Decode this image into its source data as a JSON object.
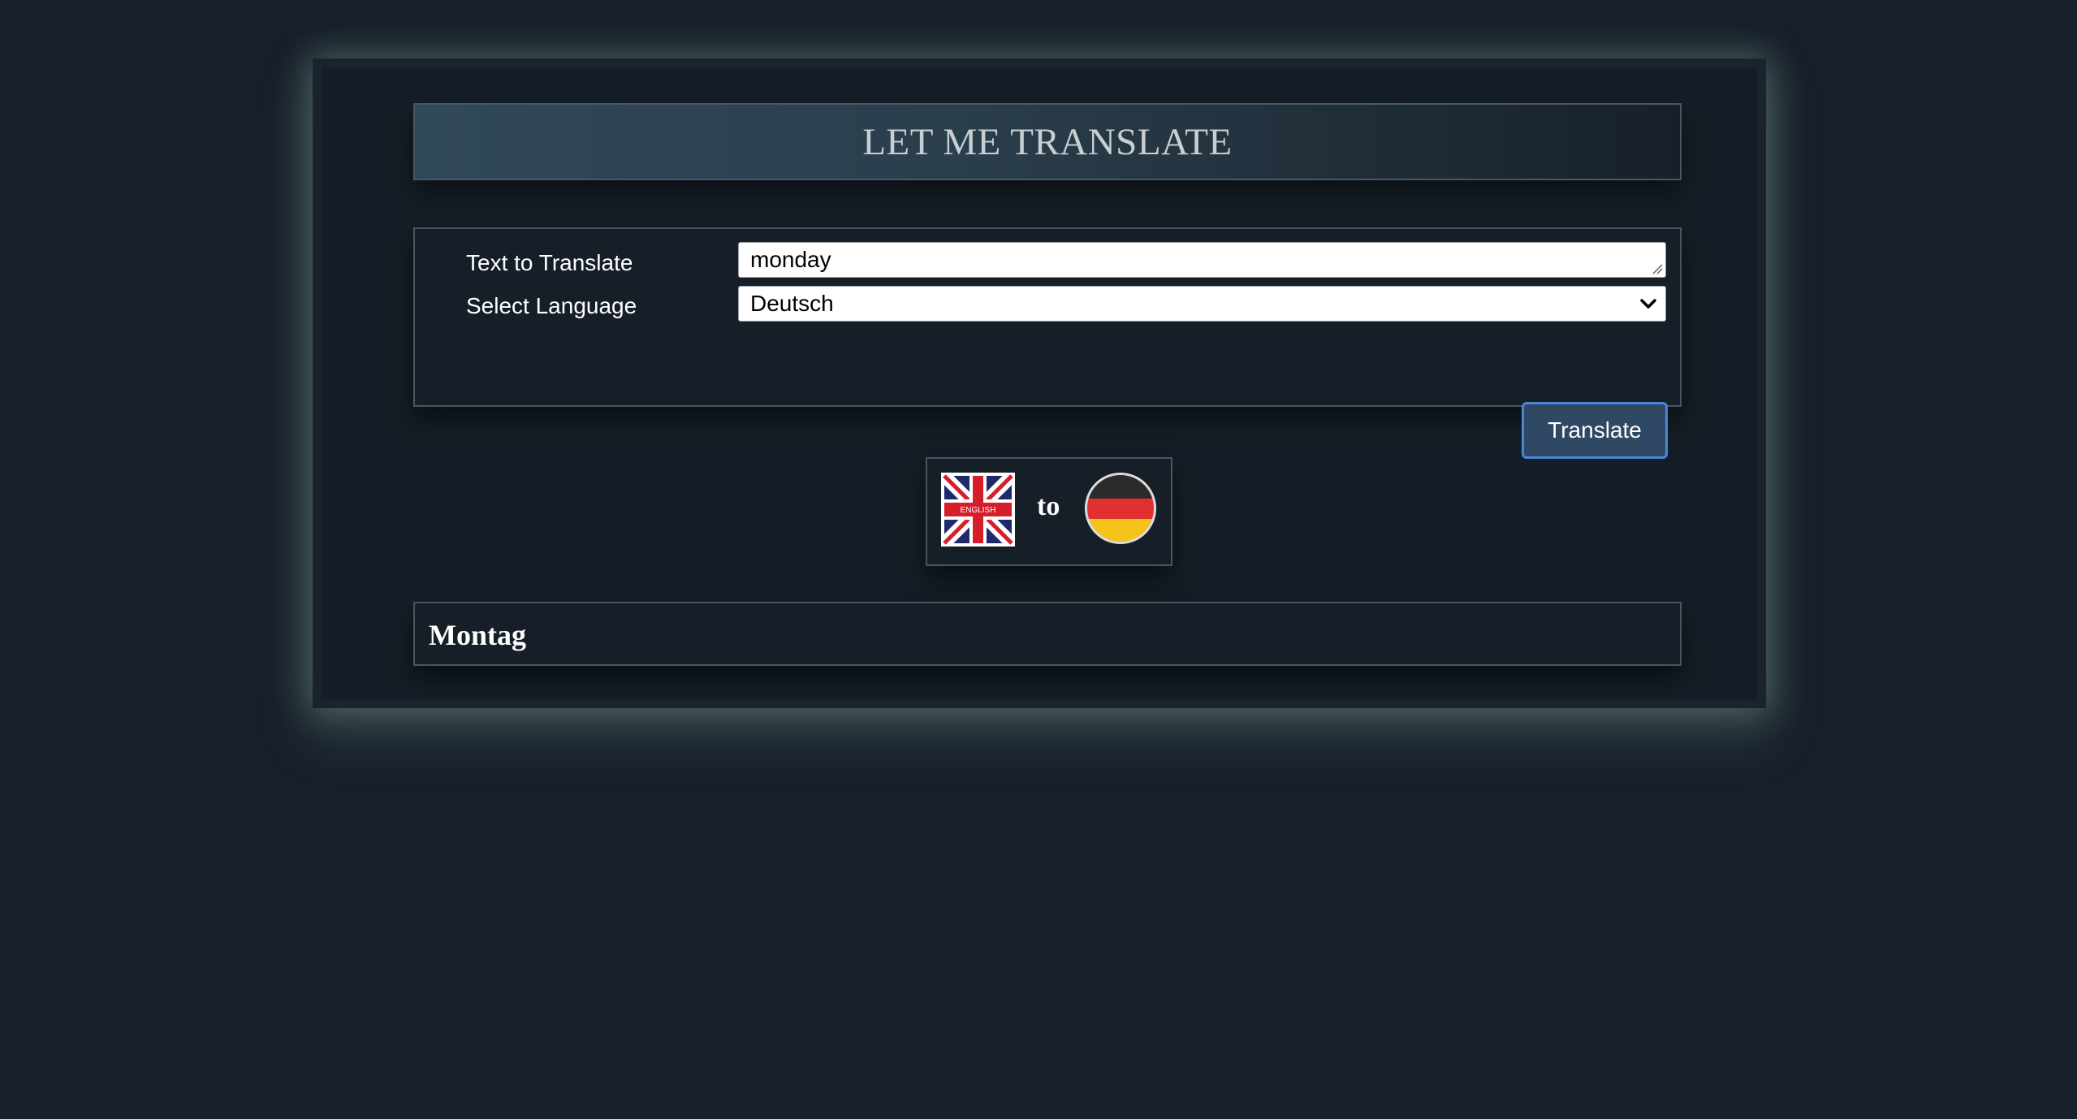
{
  "header": {
    "title": "LET ME TRANSLATE"
  },
  "form": {
    "text_label": "Text to Translate",
    "text_value": "monday",
    "language_label": "Select Language",
    "language_selected": "Deutsch",
    "translate_button": "Translate"
  },
  "flags": {
    "source_flag_icon": "uk-flag-icon",
    "source_flag_caption": "ENGLISH",
    "connector": "to",
    "target_flag_icon": "germany-flag-icon"
  },
  "result": {
    "text": "Montag"
  },
  "colors": {
    "background": "#18202a",
    "button_bg": "#2f4863",
    "button_border": "#4b86d6"
  }
}
